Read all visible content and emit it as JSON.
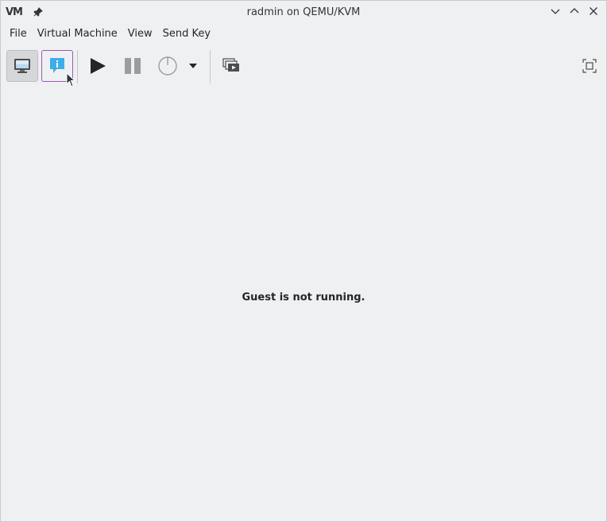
{
  "window": {
    "title": "radmin on QEMU/KVM",
    "app_logo_text": "VM"
  },
  "menubar": {
    "items": [
      "File",
      "Virtual Machine",
      "View",
      "Send Key"
    ]
  },
  "toolbar": {
    "buttons": [
      {
        "name": "console-button",
        "icon": "monitor-icon",
        "state": "checked"
      },
      {
        "name": "details-button",
        "icon": "info-bubble-icon",
        "state": "hover"
      },
      {
        "name": "run-button",
        "icon": "play-icon"
      },
      {
        "name": "pause-button",
        "icon": "pause-icon"
      },
      {
        "name": "shutdown-button",
        "icon": "power-icon"
      },
      {
        "name": "shutdown-menu-button",
        "icon": "dropdown-arrow-icon"
      },
      {
        "name": "snapshots-button",
        "icon": "snapshots-icon"
      },
      {
        "name": "fullscreen-button",
        "icon": "fullscreen-icon"
      }
    ]
  },
  "content": {
    "message": "Guest is not running."
  },
  "colors": {
    "background": "#eff0f1",
    "hover_border": "#9b59b6",
    "info_blue": "#3daee9",
    "icon_dark": "#232629",
    "icon_grey": "#9a9d9f"
  }
}
